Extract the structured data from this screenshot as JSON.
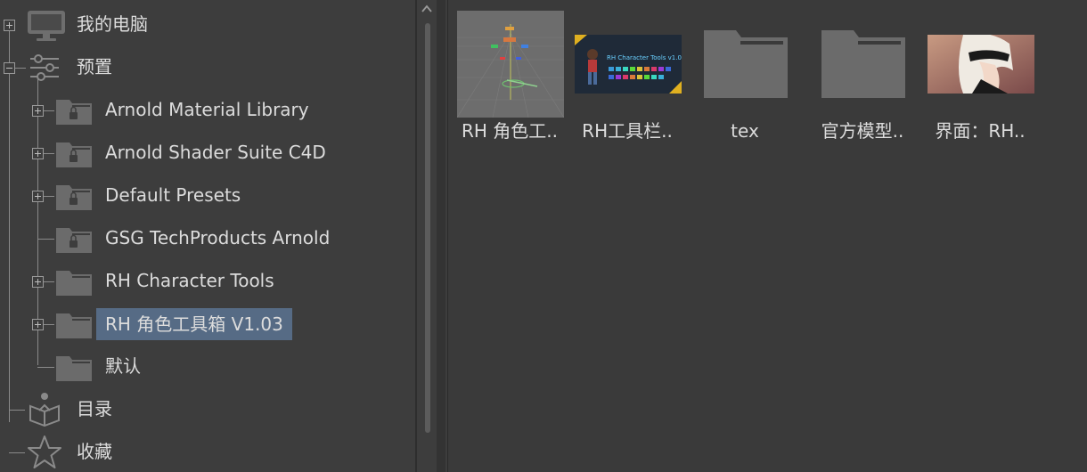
{
  "tree": {
    "items": [
      {
        "label": "我的电脑",
        "icon": "monitor-icon"
      },
      {
        "label": "预置",
        "icon": "sliders-icon"
      },
      {
        "label": "Arnold Material Library",
        "icon": "locked-folder-icon"
      },
      {
        "label": "Arnold Shader Suite C4D",
        "icon": "locked-folder-icon"
      },
      {
        "label": "Default Presets",
        "icon": "locked-folder-icon"
      },
      {
        "label": "GSG TechProducts Arnold",
        "icon": "locked-folder-icon"
      },
      {
        "label": "RH Character Tools",
        "icon": "folder-icon"
      },
      {
        "label": "RH 角色工具箱 V1.03",
        "icon": "folder-icon",
        "selected": true
      },
      {
        "label": "默认",
        "icon": "folder-icon"
      },
      {
        "label": "目录",
        "icon": "catalog-icon"
      },
      {
        "label": "收藏",
        "icon": "star-icon"
      }
    ]
  },
  "grid": {
    "items": [
      {
        "label": "RH 角色工..",
        "icon": "viewport-thumbnail"
      },
      {
        "label": "RH工具栏..",
        "icon": "banner-thumbnail",
        "banner_text": "RH Character Tools v1.0"
      },
      {
        "label": "tex",
        "icon": "folder-icon"
      },
      {
        "label": "官方模型..",
        "icon": "folder-icon"
      },
      {
        "label": "界面：RH..",
        "icon": "character-thumbnail"
      }
    ]
  },
  "colors": {
    "background": "#3d3d3d",
    "selection": "#566b85",
    "folder": "#6b6b6b",
    "text": "#dcdcdc"
  }
}
